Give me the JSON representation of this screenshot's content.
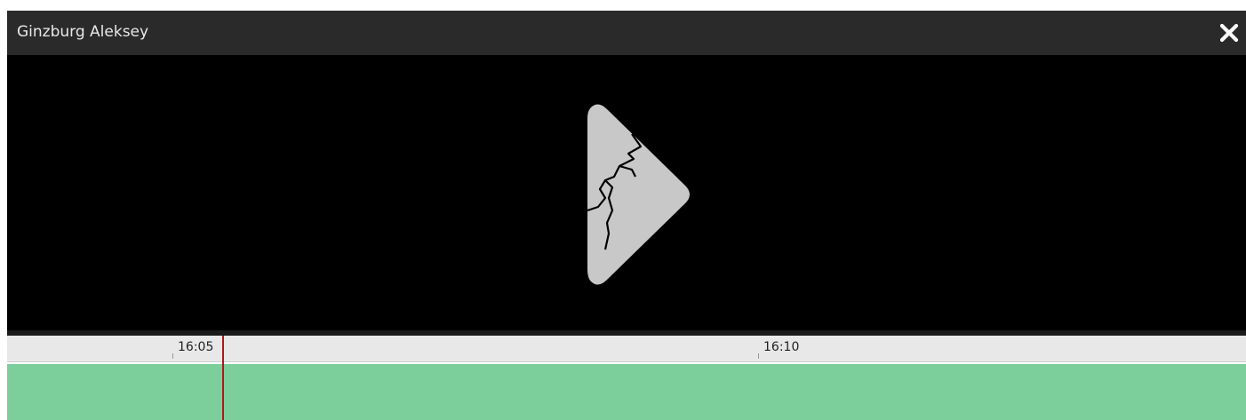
{
  "window": {
    "title": "Ginzburg Aleksey"
  },
  "icons": {
    "close": "close-icon",
    "video_placeholder": "broken-play-icon"
  },
  "timeline": {
    "ticks": [
      "16:05",
      "16:10"
    ],
    "playhead_time": "≈16:05",
    "track_color": "#7ccf9b",
    "playhead_color": "#b01818"
  }
}
